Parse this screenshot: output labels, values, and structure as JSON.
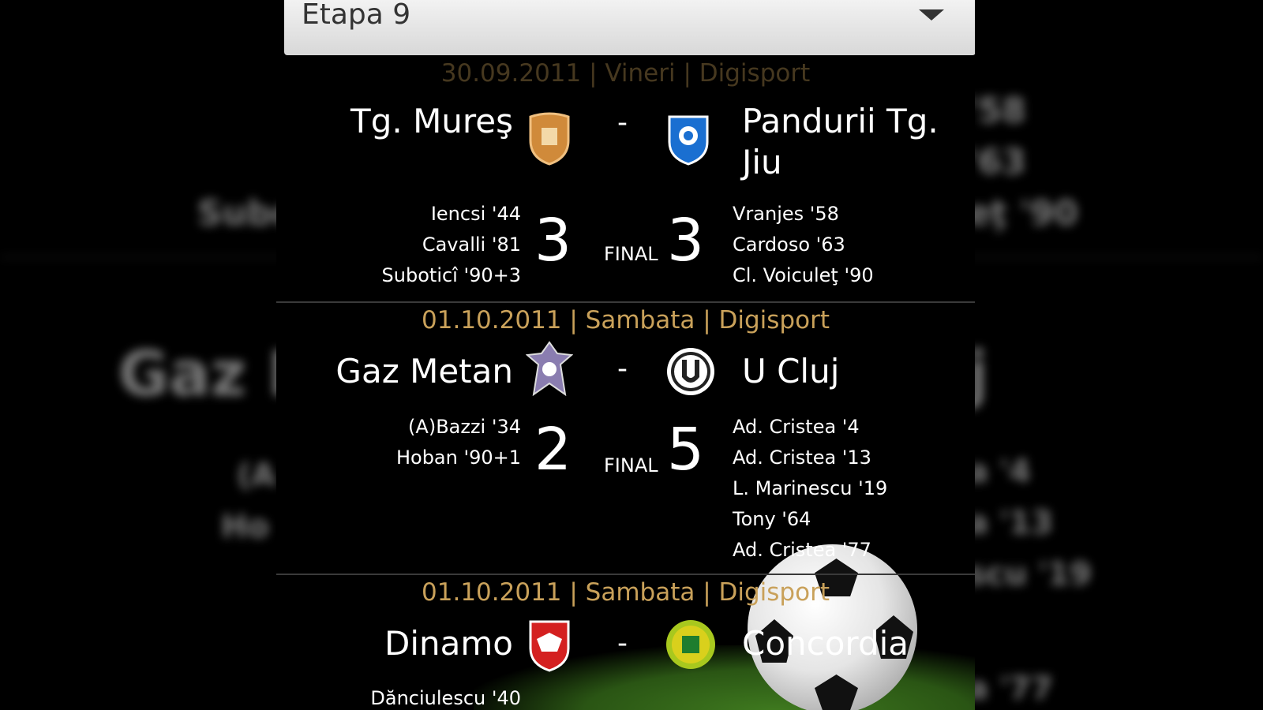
{
  "spinner": {
    "label": "Etapa 9"
  },
  "matches": [
    {
      "info": "30.09.2011 | Vineri | Digisport",
      "home": "Tg. Mureş",
      "away": "Pandurii Tg. Jiu",
      "separator": "-",
      "home_score": "3",
      "away_score": "3",
      "status": "FINAL",
      "home_scorers": [
        "Iencsi '44",
        "Cavalli '81",
        "Suboticî '90+3"
      ],
      "away_scorers": [
        "Vranjes '58",
        "Cardoso '63",
        "Cl. Voiculeţ '90"
      ]
    },
    {
      "info": "01.10.2011 | Sambata | Digisport",
      "home": "Gaz Metan",
      "away": "U Cluj",
      "separator": "-",
      "home_score": "2",
      "away_score": "5",
      "status": "FINAL",
      "home_scorers": [
        "(A)Bazzi '34",
        "Hoban '90+1"
      ],
      "away_scorers": [
        "Ad. Cristea '4",
        "Ad. Cristea '13",
        "L. Marinescu '19",
        "Tony '64",
        "Ad. Cristea '77"
      ]
    },
    {
      "info": "01.10.2011 | Sambata | Digisport",
      "home": "Dinamo",
      "away": "Concordia",
      "separator": "-",
      "home_scorers": [
        "Dănciulescu '40"
      ]
    }
  ],
  "background": {
    "fragments": [
      "Gaz M",
      "Subo",
      "(A",
      "Ho",
      "'58",
      "'63",
      "eţ '90",
      "j",
      "a '4",
      "a '13",
      "scu '19",
      "a '77"
    ]
  },
  "colors": {
    "info": "#c9a15a",
    "spinner_bg": "#e6e6e6"
  }
}
